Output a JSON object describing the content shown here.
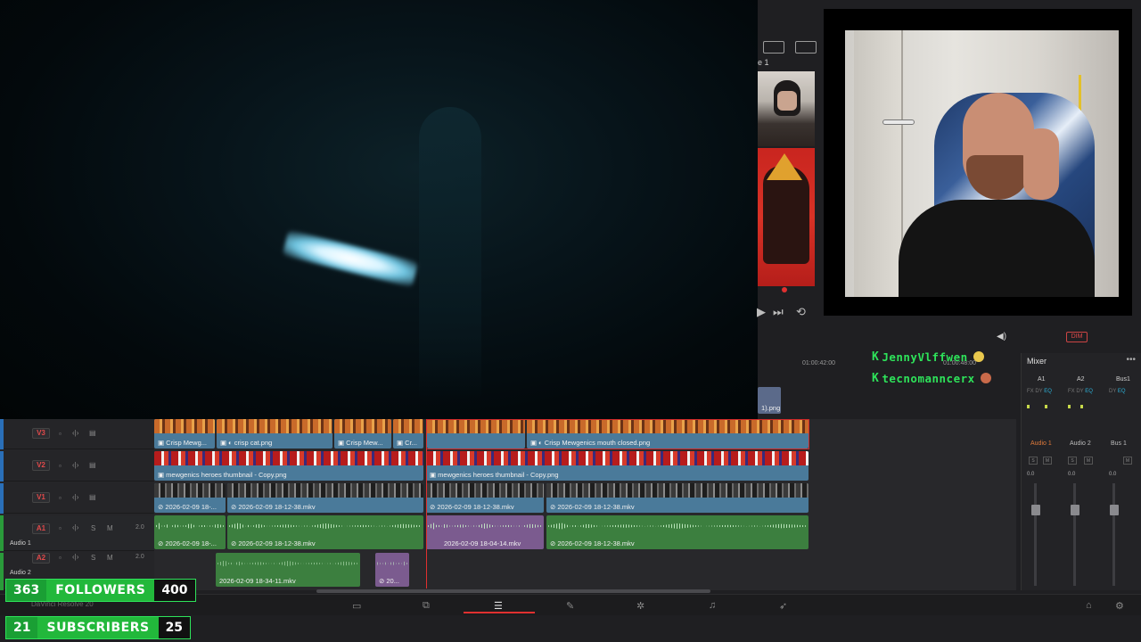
{
  "viewer": {
    "timeline_name": "e 1",
    "transport": {
      "play": "▶",
      "skip": "⏭",
      "loop": "⟲"
    }
  },
  "chat": [
    {
      "user": "JennyVlffwen",
      "badge": "K"
    },
    {
      "user": "tecnomanncerx",
      "badge": "K"
    }
  ],
  "ruler": {
    "tc1": "01:00:42:00",
    "tc2": "01:00:48:00"
  },
  "mixer": {
    "title": "Mixer",
    "channels": [
      "A1",
      "A2",
      "Bus1"
    ],
    "strips": [
      "Audio 1",
      "Audio 2",
      "Bus 1"
    ],
    "fx": [
      "FX",
      "DY",
      "EQ"
    ],
    "zero": "0.0",
    "solo": "S",
    "mute": "M",
    "dim": "DIM"
  },
  "tracks": [
    {
      "id": "V3",
      "name": ""
    },
    {
      "id": "V2",
      "name": ""
    },
    {
      "id": "V1",
      "name": ""
    },
    {
      "id": "A1",
      "name": "Audio 1",
      "vol": "2.0"
    },
    {
      "id": "A2",
      "name": "Audio 2",
      "vol": "2.0"
    }
  ],
  "clips": {
    "v3": [
      "Crisp Mewg...",
      "crisp cat.png",
      "Crisp Mew...",
      "Cr...",
      "Crisp Mewgenics mouth closed.png"
    ],
    "v3_right": "1).png",
    "v2": [
      "mewgenics heroes thumbnail - Copy.png",
      "mewgenics heroes thumbnail - Copy.png"
    ],
    "v1": [
      "2026-02-09 18-...",
      "2026-02-09 18-12-38.mkv",
      "2026-02-09 18-12-38.mkv",
      "2026-02-09 18-12-38.mkv"
    ],
    "a1": [
      "2026-02-09 18-...",
      "2026-02-09 18-12-38.mkv",
      "2026-02-09 18-04-14.mkv",
      "2026-02-09 18-12-38.mkv"
    ],
    "a2": [
      "2026-02-09 18-34-11.mkv",
      "20..."
    ]
  },
  "app": {
    "name": "DaVinci Resolve 20"
  },
  "stats": {
    "followers": {
      "count": "363",
      "label": "FOLLOWERS",
      "goal": "400"
    },
    "subscribers": {
      "count": "21",
      "label": "SUBSCRIBERS",
      "goal": "25"
    }
  },
  "colors": {
    "accent_red": "#e03030",
    "chat_green": "#2ee35a",
    "audio_clip": "#3c7f3f",
    "image_clip": "#4a7a9a"
  }
}
